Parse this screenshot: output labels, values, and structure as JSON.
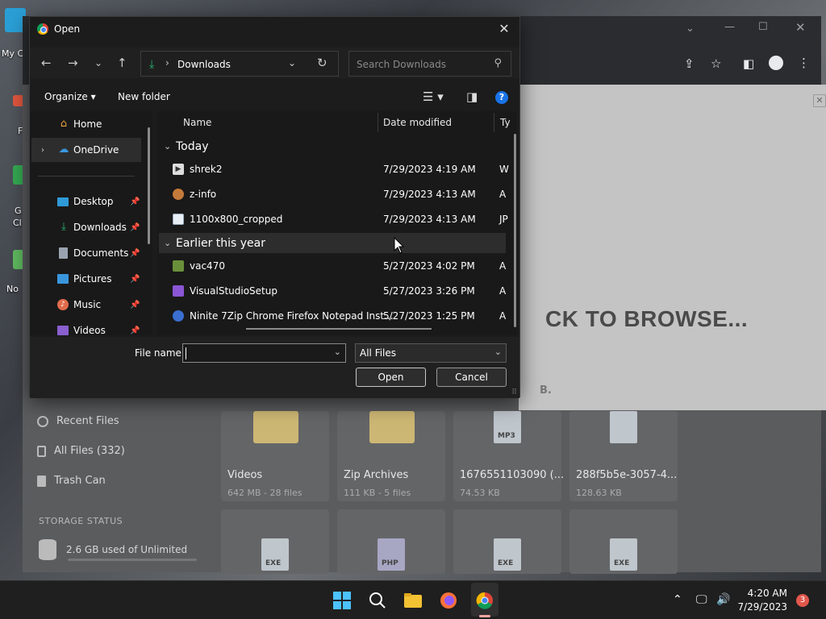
{
  "desktop": {
    "labels": [
      "My C",
      "F",
      "G",
      "Cl",
      "No"
    ]
  },
  "browser": {
    "modal_text": "CK TO BROWSE...",
    "modal_sub": "B.",
    "sidebar": [
      {
        "label": "Recent Files",
        "icon": "clock-icon"
      },
      {
        "label": "All Files (332)",
        "icon": "files-icon"
      },
      {
        "label": "Trash Can",
        "icon": "trash-icon"
      }
    ],
    "storage_title": "STORAGE STATUS",
    "storage_used": "2.6 GB used of Unlimited",
    "tiles": [
      {
        "name": "Videos",
        "meta": "642 MB - 28 files"
      },
      {
        "name": "Zip Archives",
        "meta": "111 KB - 5 files"
      },
      {
        "name": "1676551103090 (...",
        "meta": "74.53 KB",
        "badge": "MP3"
      },
      {
        "name": "288f5b5e-3057-4...",
        "meta": "128.63 KB"
      }
    ],
    "bottom_badges": [
      "EXE",
      "PHP",
      "EXE",
      "EXE"
    ]
  },
  "dialog": {
    "title": "Open",
    "address": {
      "crumb": "Downloads"
    },
    "search_placeholder": "Search Downloads",
    "commands": {
      "organize": "Organize",
      "new_folder": "New folder",
      "help": "?"
    },
    "nav": [
      {
        "label": "Home",
        "icon": "home-icon",
        "pinned": false
      },
      {
        "label": "OneDrive",
        "icon": "cloud-icon",
        "pinned": false,
        "selected": true
      },
      {
        "label": "Desktop",
        "icon": "desktop-icon",
        "pinned": true
      },
      {
        "label": "Downloads",
        "icon": "download-icon",
        "pinned": true
      },
      {
        "label": "Documents",
        "icon": "document-icon",
        "pinned": true
      },
      {
        "label": "Pictures",
        "icon": "pictures-icon",
        "pinned": true
      },
      {
        "label": "Music",
        "icon": "music-icon",
        "pinned": true
      },
      {
        "label": "Videos",
        "icon": "videos-icon",
        "pinned": true
      }
    ],
    "columns": {
      "name": "Name",
      "date": "Date modified",
      "type": "Ty"
    },
    "groups": [
      {
        "label": "Today",
        "files": [
          {
            "name": "shrek2",
            "date": "7/29/2023 4:19 AM",
            "type": "W",
            "icon": "video-file-icon"
          },
          {
            "name": "z-info",
            "date": "7/29/2023 4:13 AM",
            "type": "A",
            "icon": "app-file-icon"
          },
          {
            "name": "1100x800_cropped",
            "date": "7/29/2023 4:13 AM",
            "type": "JP",
            "icon": "image-file-icon"
          }
        ]
      },
      {
        "label": "Earlier this year",
        "files": [
          {
            "name": "vac470",
            "date": "5/27/2023 4:02 PM",
            "type": "A",
            "icon": "app-file-icon"
          },
          {
            "name": "VisualStudioSetup",
            "date": "5/27/2023 3:26 PM",
            "type": "A",
            "icon": "visual-studio-icon"
          },
          {
            "name": "Ninite 7Zip Chrome Firefox Notepad Inst...",
            "date": "5/27/2023 1:25 PM",
            "type": "A",
            "icon": "ninite-icon"
          }
        ]
      }
    ],
    "footer": {
      "file_name_label": "File name:",
      "file_name_value": "",
      "filter": "All Files",
      "open": "Open",
      "cancel": "Cancel"
    }
  },
  "taskbar": {
    "time": "4:20 AM",
    "date": "7/29/2023",
    "notifications": "3"
  },
  "colors": {
    "accent": "#1a73e8",
    "download_green": "#2bb673",
    "notif_red": "#e2574c"
  }
}
